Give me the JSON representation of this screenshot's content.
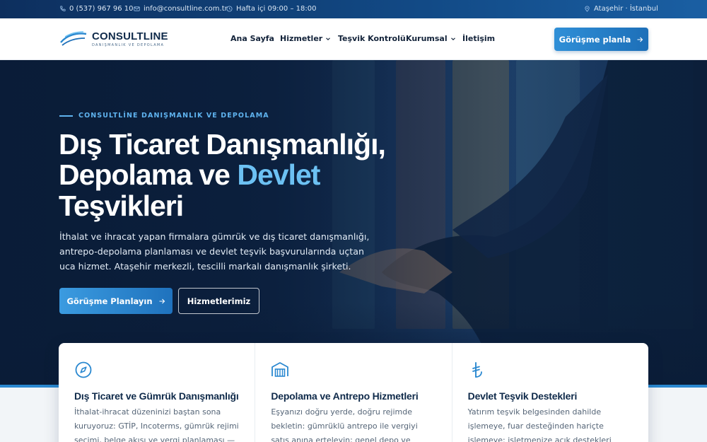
{
  "topbar": {
    "phone": "0 (537) 967 96 10",
    "email": "info@consultline.com.tr",
    "hours": "Hafta içi 09:00 – 18:00",
    "location": "Ataşehir · İstanbul"
  },
  "logo": {
    "title": "CONSULTLINE",
    "subtitle": "DANIŞMANLIK VE DEPOLAMA"
  },
  "nav": {
    "items": [
      {
        "label": "Ana Sayfa",
        "dropdown": false
      },
      {
        "label": "Hizmetler",
        "dropdown": true
      },
      {
        "label": "Teşvik Kontrolü",
        "dropdown": false
      },
      {
        "label": "Kurumsal",
        "dropdown": true
      },
      {
        "label": "İletişim",
        "dropdown": false
      }
    ],
    "cta_label": "Görüşme planla"
  },
  "hero": {
    "eyebrow": "CONSULTLİNE DANIŞMANLIK VE DEPOLAMA",
    "title_line1": "Dış Ticaret Danışmanlığı,",
    "title_line2_a": "Depolama ve ",
    "title_line2_b": "Devlet",
    "title_line3": "Teşvikleri",
    "lead": "İthalat ve ihracat yapan firmalara gümrük ve dış ticaret danışmanlığı, antrepo-depolama planlaması ve devlet teşvik başvurularında uçtan uca hizmet. Ataşehir merkezli, tescilli markalı danışmanlık şirketi.",
    "primary_button": "Görüşme Planlayın",
    "secondary_button": "Hizmetlerimiz"
  },
  "cards": [
    {
      "icon": "compass-icon",
      "title": "Dış Ticaret ve Gümrük Danışmanlığı",
      "text": "İthalat-ihracat düzeninizi baştan sona kuruyoruz: GTİP, Incoterms, gümrük rejimi seçimi, belge akışı ve vergi planlaması — cezayı"
    },
    {
      "icon": "warehouse-icon",
      "title": "Depolama ve Antrepo Hizmetleri",
      "text": "Eşyanızı doğru yerde, doğru rejimde bekletin: gümrüklü antrepo ile vergiyi satış anına erteleyin; genel depo ve elleçleme ile stok ve"
    },
    {
      "icon": "lira-icon",
      "title": "Devlet Teşvik Destekleri",
      "text": "Yatırım teşvik belgesinden dahilde işlemeye, fuar desteğinden hariçte işlemeye: işletmenize açık destekleri tespit eder, başvuruyu hazırlar..."
    }
  ],
  "colors": {
    "accent": "#2a88d0",
    "heading": "#0f2a4a",
    "topbar": "#0d2f5e"
  }
}
